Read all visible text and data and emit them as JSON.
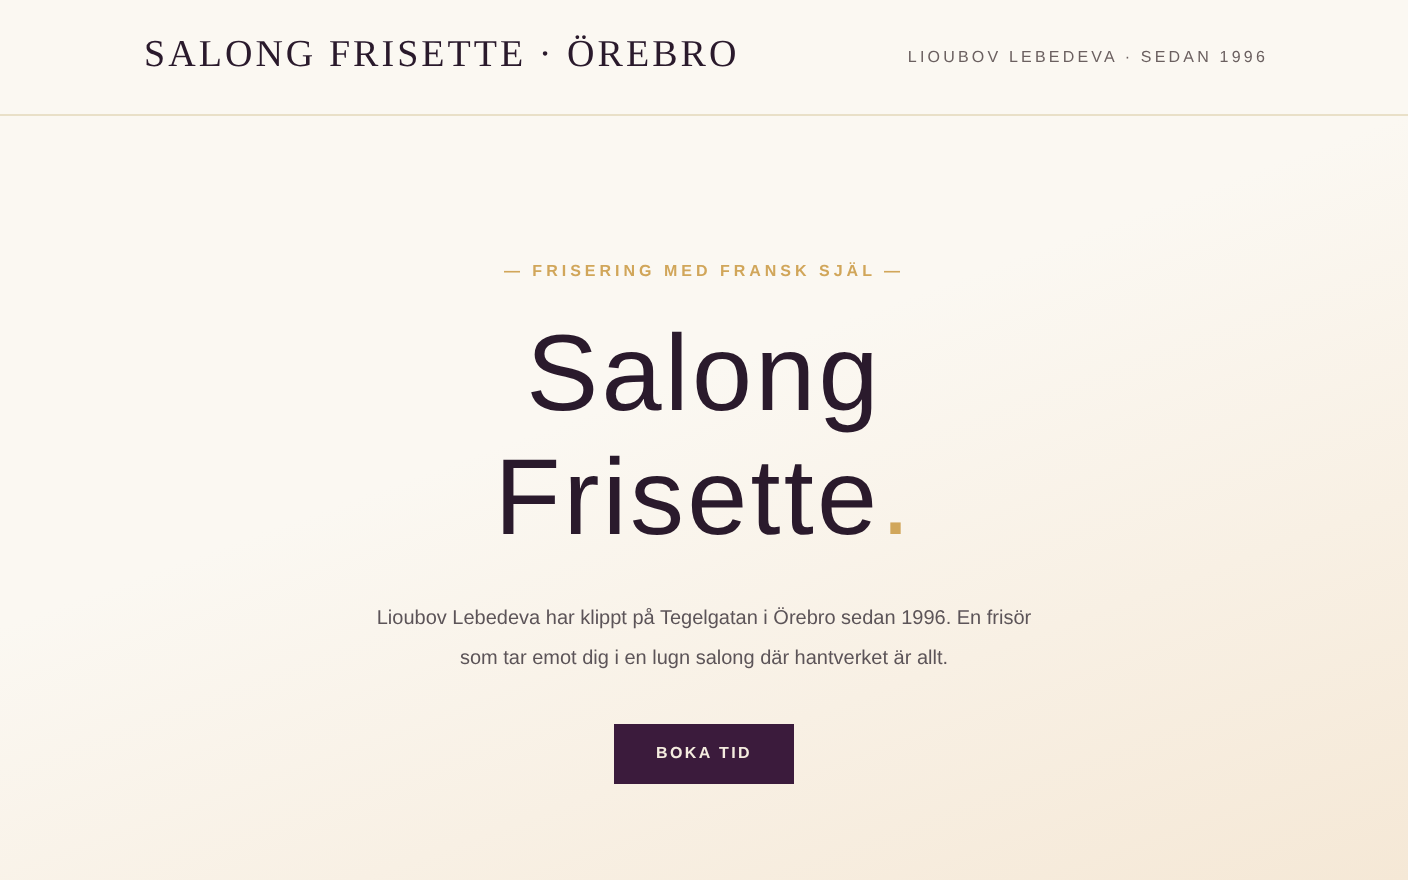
{
  "header": {
    "brand": "SALONG FRISETTE · ÖREBRO",
    "tagline": "LIOUBOV LEBEDEVA · SEDAN 1996"
  },
  "hero": {
    "eyebrow": "— FRISERING MED FRANSK SJÄL —",
    "title_lines": [
      "Salong",
      "Frisette"
    ],
    "title_accent": ".",
    "intro": "Lioubov Lebedeva har klippt på Tegelgatan i Örebro sedan 1996. En frisör som tar emot dig i en lugn salong där hantverket är allt.",
    "button": "BOKA TID"
  }
}
